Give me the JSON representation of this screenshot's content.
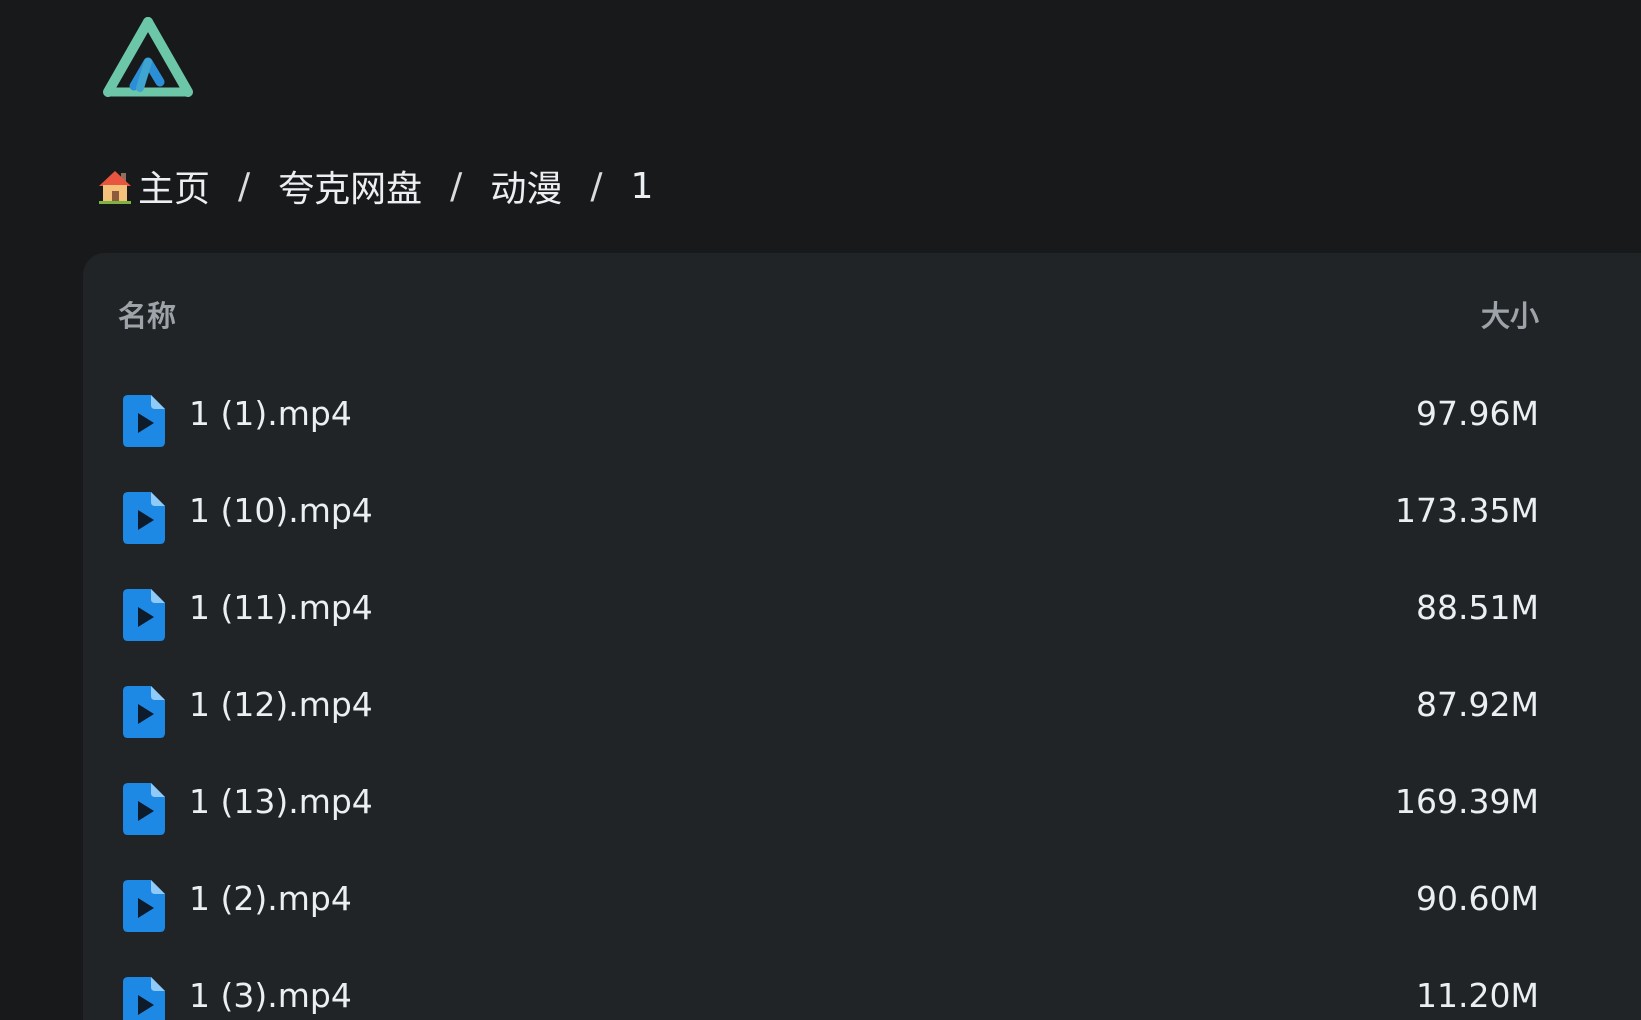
{
  "breadcrumb": {
    "home_label": "主页",
    "items": [
      "夸克网盘",
      "动漫",
      "1"
    ],
    "separator": "/"
  },
  "file_list": {
    "columns": {
      "name": "名称",
      "size": "大小"
    },
    "rows": [
      {
        "name": "1 (1).mp4",
        "size": "97.96M",
        "icon": "video-file-icon"
      },
      {
        "name": "1 (10).mp4",
        "size": "173.35M",
        "icon": "video-file-icon"
      },
      {
        "name": "1 (11).mp4",
        "size": "88.51M",
        "icon": "video-file-icon"
      },
      {
        "name": "1 (12).mp4",
        "size": "87.92M",
        "icon": "video-file-icon"
      },
      {
        "name": "1 (13).mp4",
        "size": "169.39M",
        "icon": "video-file-icon"
      },
      {
        "name": "1 (2).mp4",
        "size": "90.60M",
        "icon": "video-file-icon"
      },
      {
        "name": "1 (3).mp4",
        "size": "11.20M",
        "icon": "video-file-icon"
      }
    ]
  },
  "colors": {
    "background": "#18191b",
    "panel": "#212426",
    "accent_file_icon": "#1e88e5",
    "logo_teal": "#6cc7a8",
    "logo_blue": "#2a8fd6"
  }
}
